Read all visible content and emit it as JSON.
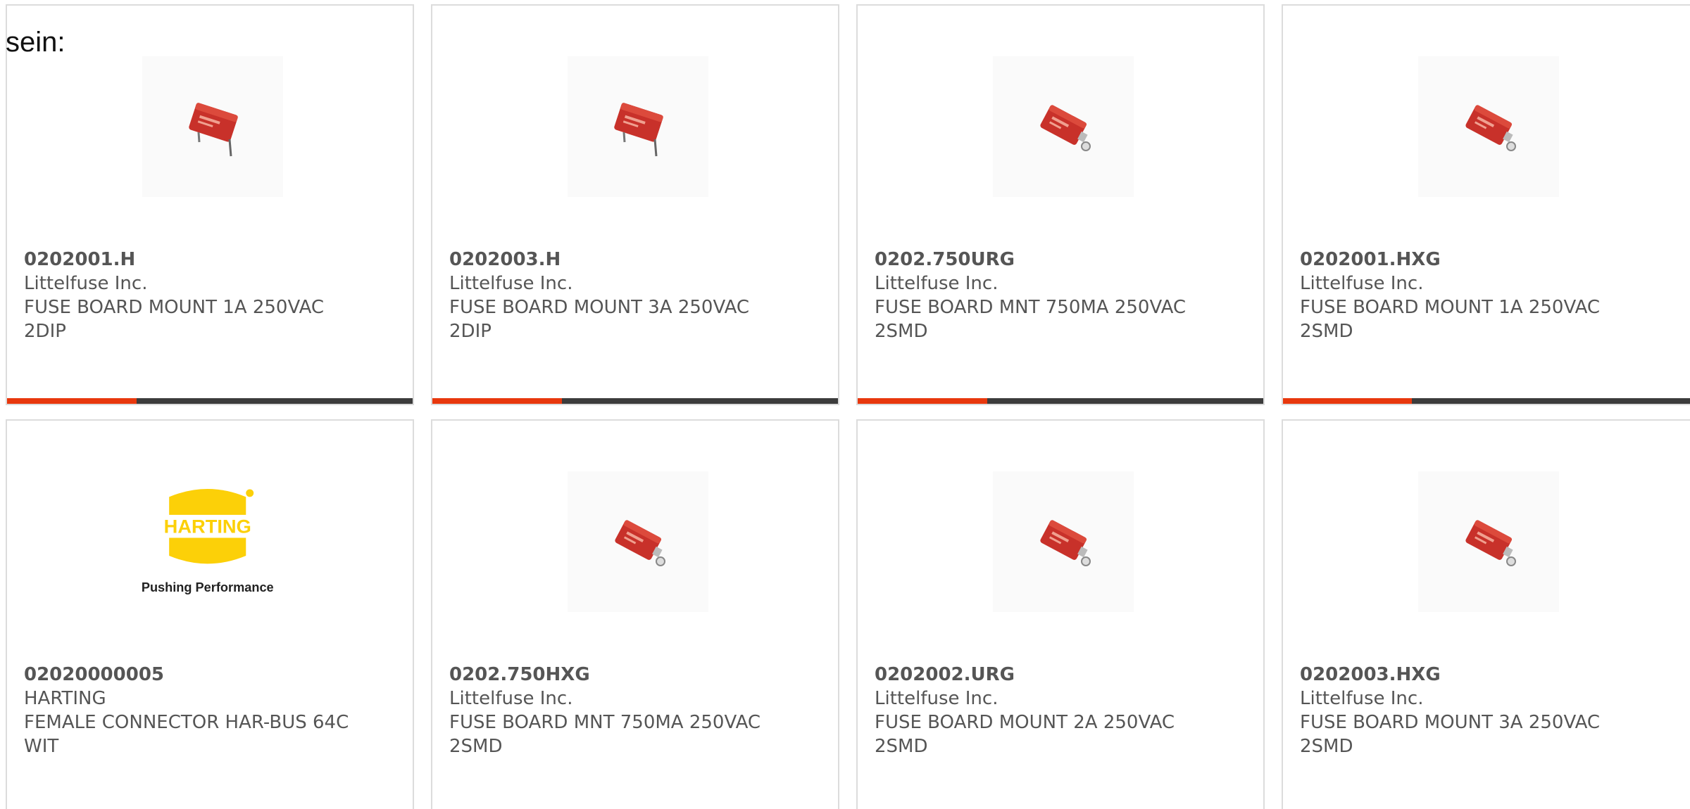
{
  "intro_text": "sein:",
  "colors": {
    "accent": "#e8380d",
    "track": "#3c3c3c",
    "border": "#dcdcdc",
    "fuse_red": "#c8312a",
    "harting_yellow": "#fcd008"
  },
  "products": [
    {
      "part": "0202001.H",
      "manufacturer": "Littelfuse Inc.",
      "description": "FUSE BOARD MOUNT 1A 250VAC 2DIP",
      "image": "fuse-2dip-image",
      "progress": 0.32
    },
    {
      "part": "0202003.H",
      "manufacturer": "Littelfuse Inc.",
      "description": "FUSE BOARD MOUNT 3A 250VAC 2DIP",
      "image": "fuse-2dip-image",
      "progress": 0.32
    },
    {
      "part": "0202.750URG",
      "manufacturer": "Littelfuse Inc.",
      "description": "FUSE BOARD MNT 750MA 250VAC 2SMD",
      "image": "fuse-2smd-image",
      "progress": 0.32
    },
    {
      "part": "0202001.HXG",
      "manufacturer": "Littelfuse Inc.",
      "description": "FUSE BOARD MOUNT 1A 250VAC 2SMD",
      "image": "fuse-2smd-image",
      "progress": 0.32
    },
    {
      "part": "02020000005",
      "manufacturer": "HARTING",
      "description": "FEMALE CONNECTOR HAR-BUS 64C WIT",
      "image": "harting-logo",
      "logo_text": "HARTING",
      "logo_tagline": "Pushing Performance"
    },
    {
      "part": "0202.750HXG",
      "manufacturer": "Littelfuse Inc.",
      "description": "FUSE BOARD MNT 750MA 250VAC 2SMD",
      "image": "fuse-2smd-image"
    },
    {
      "part": "0202002.URG",
      "manufacturer": "Littelfuse Inc.",
      "description": "FUSE BOARD MOUNT 2A 250VAC 2SMD",
      "image": "fuse-2smd-image"
    },
    {
      "part": "0202003.HXG",
      "manufacturer": "Littelfuse Inc.",
      "description": "FUSE BOARD MOUNT 3A 250VAC 2SMD",
      "image": "fuse-2smd-image"
    }
  ]
}
